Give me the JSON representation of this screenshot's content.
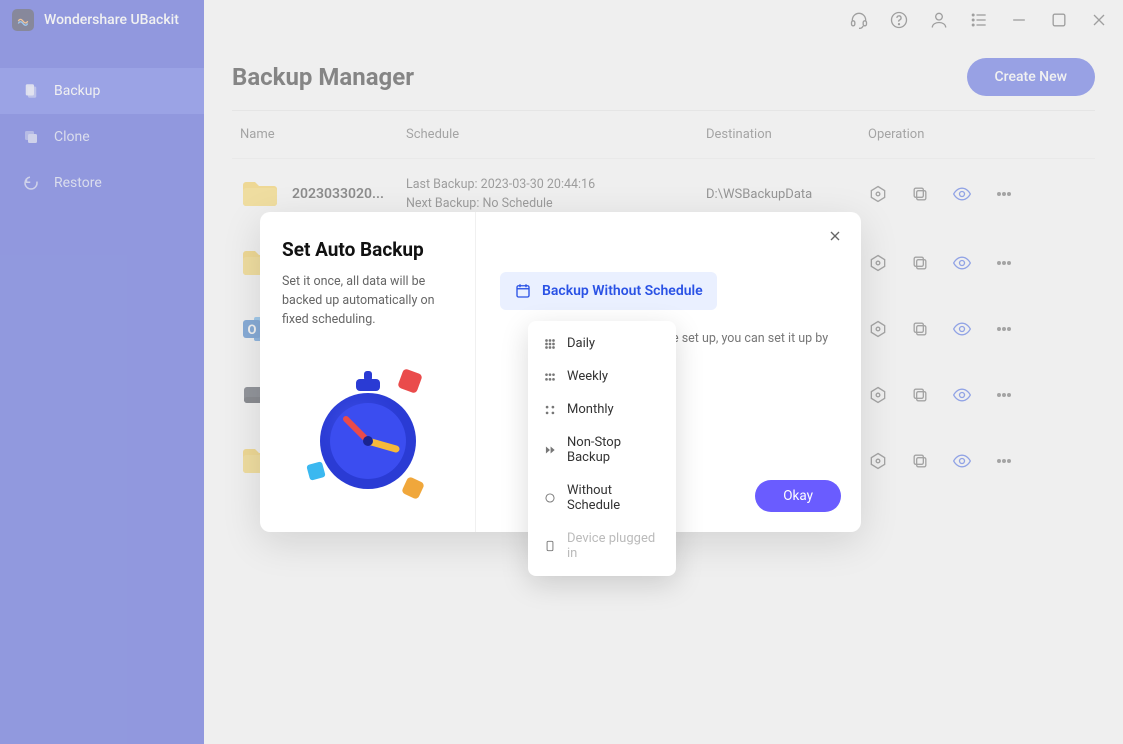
{
  "brand": {
    "title": "Wondershare UBackit"
  },
  "sidebar": {
    "items": [
      {
        "label": "Backup"
      },
      {
        "label": "Clone"
      },
      {
        "label": "Restore"
      }
    ]
  },
  "header": {
    "title": "Backup Manager",
    "create_label": "Create New"
  },
  "columns": {
    "name": "Name",
    "schedule": "Schedule",
    "destination": "Destination",
    "operation": "Operation"
  },
  "rows": [
    {
      "name": "2023033020...",
      "last": "Last Backup: 2023-03-30 20:44:16",
      "next": "Next Backup: No Schedule",
      "dest": "D:\\WSBackupData",
      "icon": "folder"
    },
    {
      "name": "",
      "last": "",
      "next": "",
      "dest": "",
      "icon": "folder"
    },
    {
      "name": "",
      "last": "",
      "next": "",
      "dest": "",
      "icon": "outlook"
    },
    {
      "name": "",
      "last": "",
      "next": "",
      "dest": "",
      "icon": "disk"
    },
    {
      "name": "",
      "last": "",
      "next": "",
      "dest": "",
      "icon": "folder"
    }
  ],
  "modal": {
    "title": "Set Auto Backup",
    "desc": "Set it once, all data will be backed up automatically on fixed scheduling.",
    "chip_label": "Backup Without Schedule",
    "hint": "e set up, you can set it up by",
    "okay": "Okay"
  },
  "dropdown": {
    "items": [
      {
        "label": "Daily",
        "icon": "grid"
      },
      {
        "label": "Weekly",
        "icon": "grid"
      },
      {
        "label": "Monthly",
        "icon": "grid"
      },
      {
        "label": "Non-Stop Backup",
        "icon": "ff"
      },
      {
        "label": "Without Schedule",
        "icon": "circle"
      },
      {
        "label": "Device plugged in",
        "icon": "device",
        "disabled": true
      }
    ]
  }
}
